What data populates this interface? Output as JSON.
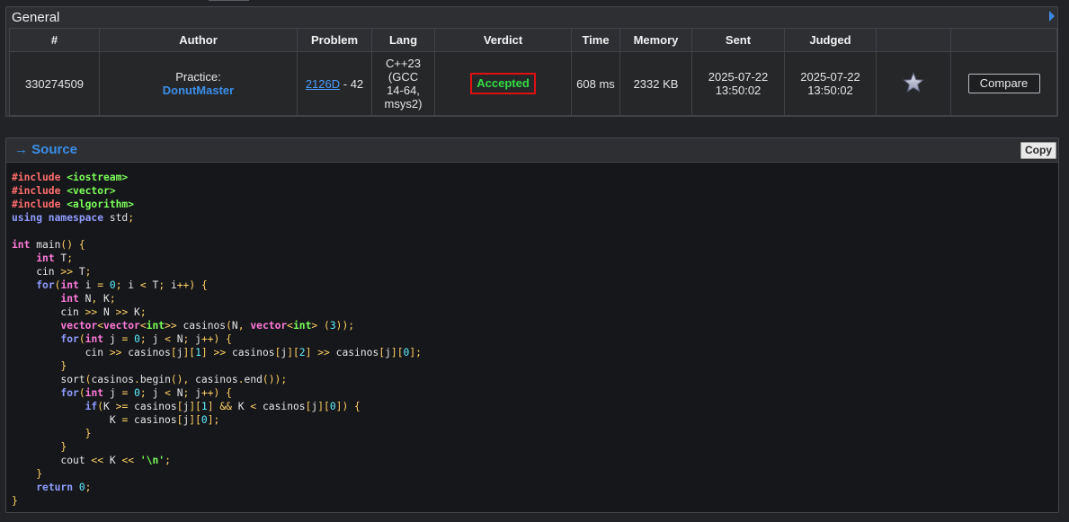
{
  "general": {
    "title": "General",
    "columns": [
      "#",
      "Author",
      "Problem",
      "Lang",
      "Verdict",
      "Time",
      "Memory",
      "Sent",
      "Judged",
      "",
      ""
    ],
    "row": {
      "id": "330274509",
      "author_prefix": "Practice:",
      "author_name": "DonutMaster",
      "problem_link": "2126D",
      "problem_suffix": " - 42",
      "lang_lines": [
        "C++23",
        "(GCC",
        "14-64,",
        "msys2)"
      ],
      "verdict": "Accepted",
      "time": "608 ms",
      "memory": "2332 KB",
      "sent_date": "2025-07-22",
      "sent_time": "13:50:02",
      "judged_date": "2025-07-22",
      "judged_time": "13:50:02",
      "compare_label": "Compare"
    }
  },
  "source": {
    "arrow": "→",
    "title": "Source",
    "copy_label": "Copy",
    "code_lines": [
      [
        [
          "prep",
          "#include "
        ],
        [
          "inc",
          "<iostream>"
        ]
      ],
      [
        [
          "prep",
          "#include "
        ],
        [
          "inc",
          "<vector>"
        ]
      ],
      [
        [
          "prep",
          "#include "
        ],
        [
          "inc",
          "<algorithm>"
        ]
      ],
      [
        [
          "ty",
          "using namespace"
        ],
        [
          "plain",
          " std"
        ],
        [
          "op",
          ";"
        ]
      ],
      [],
      [
        [
          "kw",
          "int"
        ],
        [
          "plain",
          " main"
        ],
        [
          "op",
          "() {"
        ]
      ],
      [
        [
          "plain",
          "    "
        ],
        [
          "kw",
          "int"
        ],
        [
          "plain",
          " T"
        ],
        [
          "op",
          ";"
        ]
      ],
      [
        [
          "plain",
          "    cin "
        ],
        [
          "op",
          ">>"
        ],
        [
          "plain",
          " T"
        ],
        [
          "op",
          ";"
        ]
      ],
      [
        [
          "plain",
          "    "
        ],
        [
          "ty",
          "for"
        ],
        [
          "op",
          "("
        ],
        [
          "kw",
          "int"
        ],
        [
          "plain",
          " i "
        ],
        [
          "op",
          "="
        ],
        [
          "plain",
          " "
        ],
        [
          "num",
          "0"
        ],
        [
          "op",
          ";"
        ],
        [
          "plain",
          " i "
        ],
        [
          "op",
          "<"
        ],
        [
          "plain",
          " T"
        ],
        [
          "op",
          ";"
        ],
        [
          "plain",
          " i"
        ],
        [
          "op",
          "++) {"
        ]
      ],
      [
        [
          "plain",
          "        "
        ],
        [
          "kw",
          "int"
        ],
        [
          "plain",
          " N"
        ],
        [
          "op",
          ","
        ],
        [
          "plain",
          " K"
        ],
        [
          "op",
          ";"
        ]
      ],
      [
        [
          "plain",
          "        cin "
        ],
        [
          "op",
          ">>"
        ],
        [
          "plain",
          " N "
        ],
        [
          "op",
          ">>"
        ],
        [
          "plain",
          " K"
        ],
        [
          "op",
          ";"
        ]
      ],
      [
        [
          "plain",
          "        "
        ],
        [
          "kw",
          "vector"
        ],
        [
          "op",
          "<"
        ],
        [
          "kw",
          "vector"
        ],
        [
          "op",
          "<"
        ],
        [
          "inc",
          "int"
        ],
        [
          "op",
          ">>"
        ],
        [
          "plain",
          " casinos"
        ],
        [
          "op",
          "("
        ],
        [
          "plain",
          "N"
        ],
        [
          "op",
          ","
        ],
        [
          "plain",
          " "
        ],
        [
          "kw",
          "vector"
        ],
        [
          "op",
          "<"
        ],
        [
          "inc",
          "int"
        ],
        [
          "op",
          ">"
        ],
        [
          "plain",
          " "
        ],
        [
          "op",
          "("
        ],
        [
          "num",
          "3"
        ],
        [
          "op",
          "));"
        ]
      ],
      [
        [
          "plain",
          "        "
        ],
        [
          "ty",
          "for"
        ],
        [
          "op",
          "("
        ],
        [
          "kw",
          "int"
        ],
        [
          "plain",
          " j "
        ],
        [
          "op",
          "="
        ],
        [
          "plain",
          " "
        ],
        [
          "num",
          "0"
        ],
        [
          "op",
          ";"
        ],
        [
          "plain",
          " j "
        ],
        [
          "op",
          "<"
        ],
        [
          "plain",
          " N"
        ],
        [
          "op",
          ";"
        ],
        [
          "plain",
          " j"
        ],
        [
          "op",
          "++) {"
        ]
      ],
      [
        [
          "plain",
          "            cin "
        ],
        [
          "op",
          ">>"
        ],
        [
          "plain",
          " casinos"
        ],
        [
          "op",
          "["
        ],
        [
          "plain",
          "j"
        ],
        [
          "op",
          "]["
        ],
        [
          "num",
          "1"
        ],
        [
          "op",
          "]"
        ],
        [
          "plain",
          " "
        ],
        [
          "op",
          ">>"
        ],
        [
          "plain",
          " casinos"
        ],
        [
          "op",
          "["
        ],
        [
          "plain",
          "j"
        ],
        [
          "op",
          "]["
        ],
        [
          "num",
          "2"
        ],
        [
          "op",
          "]"
        ],
        [
          "plain",
          " "
        ],
        [
          "op",
          ">>"
        ],
        [
          "plain",
          " casinos"
        ],
        [
          "op",
          "["
        ],
        [
          "plain",
          "j"
        ],
        [
          "op",
          "]["
        ],
        [
          "num",
          "0"
        ],
        [
          "op",
          "];"
        ]
      ],
      [
        [
          "plain",
          "        "
        ],
        [
          "op",
          "}"
        ]
      ],
      [
        [
          "plain",
          "        sort"
        ],
        [
          "op",
          "("
        ],
        [
          "plain",
          "casinos"
        ],
        [
          "op",
          "."
        ],
        [
          "plain",
          "begin"
        ],
        [
          "op",
          "(),"
        ],
        [
          "plain",
          " casinos"
        ],
        [
          "op",
          "."
        ],
        [
          "plain",
          "end"
        ],
        [
          "op",
          "());"
        ]
      ],
      [
        [
          "plain",
          "        "
        ],
        [
          "ty",
          "for"
        ],
        [
          "op",
          "("
        ],
        [
          "kw",
          "int"
        ],
        [
          "plain",
          " j "
        ],
        [
          "op",
          "="
        ],
        [
          "plain",
          " "
        ],
        [
          "num",
          "0"
        ],
        [
          "op",
          ";"
        ],
        [
          "plain",
          " j "
        ],
        [
          "op",
          "<"
        ],
        [
          "plain",
          " N"
        ],
        [
          "op",
          ";"
        ],
        [
          "plain",
          " j"
        ],
        [
          "op",
          "++) {"
        ]
      ],
      [
        [
          "plain",
          "            "
        ],
        [
          "ty",
          "if"
        ],
        [
          "op",
          "("
        ],
        [
          "plain",
          "K "
        ],
        [
          "op",
          ">="
        ],
        [
          "plain",
          " casinos"
        ],
        [
          "op",
          "["
        ],
        [
          "plain",
          "j"
        ],
        [
          "op",
          "]["
        ],
        [
          "num",
          "1"
        ],
        [
          "op",
          "]"
        ],
        [
          "plain",
          " "
        ],
        [
          "op",
          "&&"
        ],
        [
          "plain",
          " K "
        ],
        [
          "op",
          "<"
        ],
        [
          "plain",
          " casinos"
        ],
        [
          "op",
          "["
        ],
        [
          "plain",
          "j"
        ],
        [
          "op",
          "]["
        ],
        [
          "num",
          "0"
        ],
        [
          "op",
          "]) {"
        ]
      ],
      [
        [
          "plain",
          "                K "
        ],
        [
          "op",
          "="
        ],
        [
          "plain",
          " casinos"
        ],
        [
          "op",
          "["
        ],
        [
          "plain",
          "j"
        ],
        [
          "op",
          "]["
        ],
        [
          "num",
          "0"
        ],
        [
          "op",
          "];"
        ]
      ],
      [
        [
          "plain",
          "            "
        ],
        [
          "op",
          "}"
        ]
      ],
      [
        [
          "plain",
          "        "
        ],
        [
          "op",
          "}"
        ]
      ],
      [
        [
          "plain",
          "        cout "
        ],
        [
          "op",
          "<<"
        ],
        [
          "plain",
          " K "
        ],
        [
          "op",
          "<<"
        ],
        [
          "plain",
          " "
        ],
        [
          "str",
          "'\\n'"
        ],
        [
          "op",
          ";"
        ]
      ],
      [
        [
          "plain",
          "    "
        ],
        [
          "op",
          "}"
        ]
      ],
      [
        [
          "plain",
          "    "
        ],
        [
          "ty",
          "return"
        ],
        [
          "plain",
          " "
        ],
        [
          "num",
          "0"
        ],
        [
          "op",
          ";"
        ]
      ],
      [
        [
          "op",
          "}"
        ]
      ]
    ]
  },
  "colors": {
    "accepted": "#33dd44",
    "verdict_border": "#e01010",
    "link": "#4a9fff",
    "author": "#3b8ee8"
  },
  "icons": {
    "general_expand": "triangle-right-icon",
    "favourite": "star-icon",
    "source_arrow": "arrow-right-icon"
  }
}
